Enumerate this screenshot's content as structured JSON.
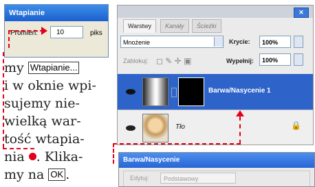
{
  "feather_dialog": {
    "title": "Wtapianie",
    "radius_label": "Promień:",
    "radius_value": "10",
    "unit": "piks"
  },
  "article": {
    "line1_prefix": "my",
    "line1_button": "Wtapianie...",
    "line2": "i w oknie wpi-",
    "line3": "sujemy nie-",
    "line4": "wielką war-",
    "line5": "tość wtapia-",
    "line6_prefix": "nia",
    "line6_suffix": ". Klika-",
    "line7_prefix": "my na",
    "line7_button": "OK",
    "line7_suffix": "."
  },
  "layers_panel": {
    "tabs": [
      "Warstwy",
      "Kanały",
      "Ścieżki"
    ],
    "blend_mode": "Mnożenie",
    "opacity_label": "Krycie:",
    "opacity_value": "100%",
    "lock_label": "Zablokuj:",
    "fill_label": "Wypełnij:",
    "fill_value": "100%",
    "layers": [
      {
        "name": "Barwa/Nasycenie 1",
        "selected": true
      },
      {
        "name": "Tło",
        "selected": false
      }
    ]
  },
  "huesat_dialog": {
    "title": "Barwa/Nasycenie",
    "edit_label": "Edytuj:",
    "edit_value": "Podstawowy"
  },
  "colors": {
    "accent_red": "#e3001b",
    "selection_blue": "#2e63c9",
    "titlebar_blue": "#1c5fd0"
  }
}
